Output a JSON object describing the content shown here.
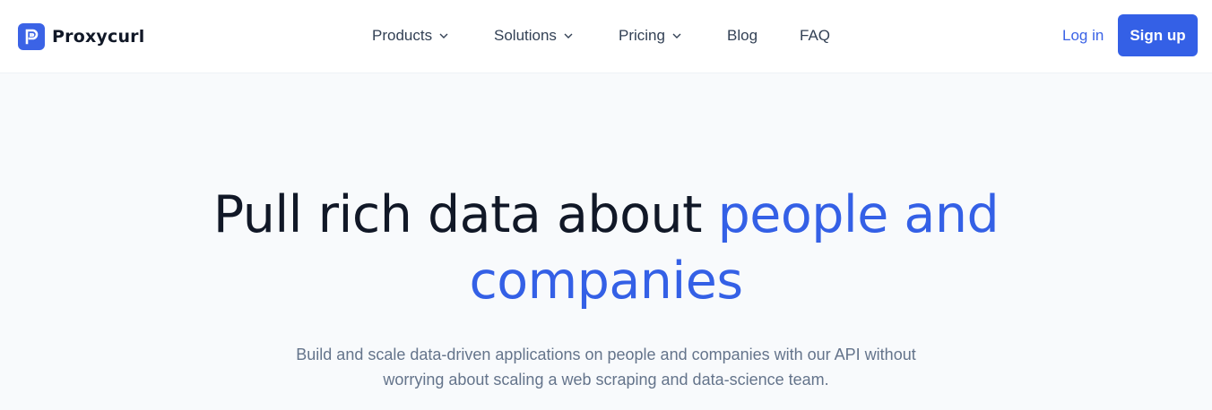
{
  "brand": {
    "name": "Proxycurl",
    "logo_icon": "proxycurl-p-logo-icon",
    "color": "#3b63e6"
  },
  "nav": {
    "items": [
      {
        "label": "Products",
        "has_dropdown": true
      },
      {
        "label": "Solutions",
        "has_dropdown": true
      },
      {
        "label": "Pricing",
        "has_dropdown": true
      },
      {
        "label": "Blog",
        "has_dropdown": false
      },
      {
        "label": "FAQ",
        "has_dropdown": false
      }
    ],
    "dropdown_icon": "chevron-down-icon"
  },
  "auth": {
    "login_label": "Log in",
    "signup_label": "Sign up"
  },
  "hero": {
    "title_plain": "Pull rich data about",
    "title_accent_line1": "people and",
    "title_accent_line2": "companies",
    "subtitle_line1": "Build and scale data-driven applications on people and companies with our API without",
    "subtitle_line2": "worrying about scaling a web scraping and data-science team."
  },
  "colors": {
    "accent": "#3460e6",
    "heading": "#111827",
    "body_text": "#64748b",
    "nav_text": "#334155",
    "background": "#f8fafc"
  }
}
